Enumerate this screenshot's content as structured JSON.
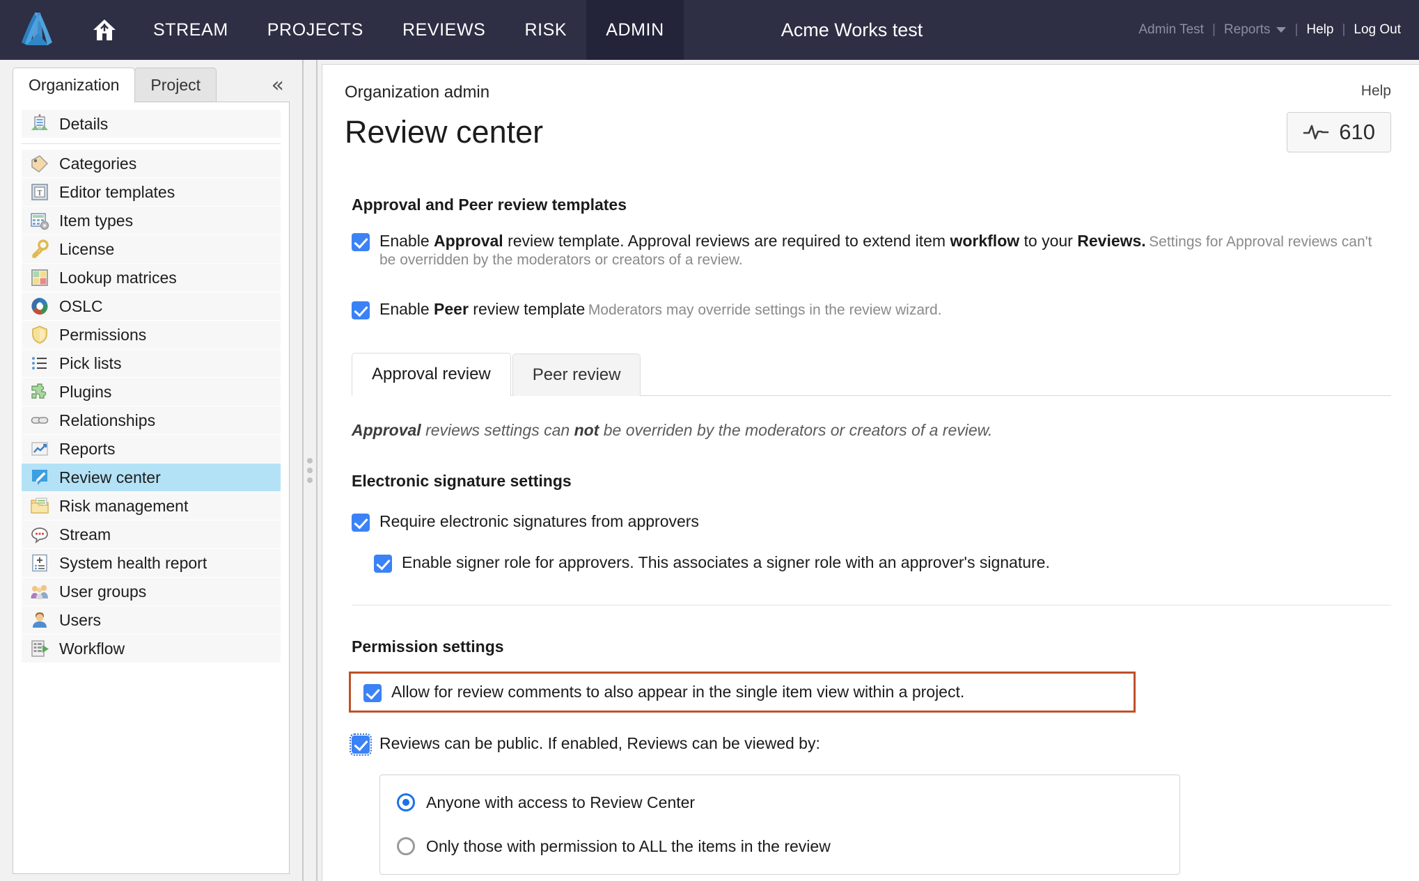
{
  "topnav": {
    "logo_icon": "jama-logo-icon",
    "home_icon": "home-icon",
    "tabs": [
      {
        "label": "STREAM",
        "active": false
      },
      {
        "label": "PROJECTS",
        "active": false
      },
      {
        "label": "REVIEWS",
        "active": false
      },
      {
        "label": "RISK",
        "active": false
      },
      {
        "label": "ADMIN",
        "active": true
      }
    ],
    "org_title": "Acme Works test",
    "user": "Admin Test",
    "reports": "Reports",
    "help": "Help",
    "logout": "Log Out",
    "sep": "|"
  },
  "sidebar": {
    "tabs": [
      {
        "label": "Organization",
        "active": true
      },
      {
        "label": "Project",
        "active": false
      }
    ],
    "collapse_icon": "chevron-double-left-icon",
    "items": [
      {
        "label": "Details",
        "icon": "building-icon",
        "selected": false,
        "sep_after": true
      },
      {
        "label": "Categories",
        "icon": "tag-icon",
        "selected": false
      },
      {
        "label": "Editor templates",
        "icon": "text-template-icon",
        "selected": false
      },
      {
        "label": "Item types",
        "icon": "item-types-icon",
        "selected": false
      },
      {
        "label": "License",
        "icon": "key-icon",
        "selected": false
      },
      {
        "label": "Lookup matrices",
        "icon": "matrix-icon",
        "selected": false
      },
      {
        "label": "OSLC",
        "icon": "oslc-ring-icon",
        "selected": false
      },
      {
        "label": "Permissions",
        "icon": "shield-icon",
        "selected": false
      },
      {
        "label": "Pick lists",
        "icon": "list-icon",
        "selected": false
      },
      {
        "label": "Plugins",
        "icon": "puzzle-icon",
        "selected": false
      },
      {
        "label": "Relationships",
        "icon": "chain-link-icon",
        "selected": false
      },
      {
        "label": "Reports",
        "icon": "chart-line-icon",
        "selected": false
      },
      {
        "label": "Review center",
        "icon": "pencil-note-icon",
        "selected": true
      },
      {
        "label": "Risk management",
        "icon": "folder-doc-icon",
        "selected": false
      },
      {
        "label": "Stream",
        "icon": "speech-bubble-icon",
        "selected": false
      },
      {
        "label": "System health report",
        "icon": "clipboard-health-icon",
        "selected": false
      },
      {
        "label": "User groups",
        "icon": "users-group-icon",
        "selected": false
      },
      {
        "label": "Users",
        "icon": "user-icon",
        "selected": false
      },
      {
        "label": "Workflow",
        "icon": "workflow-icon",
        "selected": false
      }
    ]
  },
  "main": {
    "breadcrumb": "Organization admin",
    "help_link": "Help",
    "page_title": "Review center",
    "pulse_badge": {
      "icon": "activity-pulse-icon",
      "value": "610"
    },
    "templates_section": {
      "heading": "Approval and Peer review templates",
      "approval": {
        "checked": true,
        "text_parts": [
          {
            "t": "Enable ",
            "bold": false
          },
          {
            "t": "Approval",
            "bold": true
          },
          {
            "t": " review template. Approval reviews are required to extend item ",
            "bold": false
          },
          {
            "t": "workflow",
            "bold": true
          },
          {
            "t": " to your ",
            "bold": false
          },
          {
            "t": "Reviews.",
            "bold": true
          }
        ],
        "sub": "Settings for Approval reviews can't be overridden by the moderators or creators of a review."
      },
      "peer": {
        "checked": true,
        "text_parts": [
          {
            "t": "Enable ",
            "bold": false
          },
          {
            "t": "Peer",
            "bold": true
          },
          {
            "t": " review template",
            "bold": false
          }
        ],
        "sub": "Moderators may override settings in the review wizard."
      }
    },
    "review_tabs": [
      {
        "label": "Approval review",
        "active": true
      },
      {
        "label": "Peer review",
        "active": false
      }
    ],
    "override_note_parts": [
      {
        "t": "Approval",
        "bold": true
      },
      {
        "t": " reviews settings can ",
        "bold": false
      },
      {
        "t": "not",
        "bold": true
      },
      {
        "t": " be overriden by the moderators or creators of a review.",
        "bold": false
      }
    ],
    "esig_section": {
      "heading": "Electronic signature settings",
      "require_sig": {
        "checked": true,
        "label": "Require electronic signatures from approvers"
      },
      "signer_role": {
        "checked": true,
        "label": "Enable signer role for approvers. This associates a signer role with an approver's signature."
      }
    },
    "permission_section": {
      "heading": "Permission settings",
      "comments_in_item_view": {
        "checked": true,
        "highlighted": true,
        "label": "Allow for review comments to also appear in the single item view within a project."
      },
      "public_reviews": {
        "checked": true,
        "focused": true,
        "label": "Reviews can be public. If enabled, Reviews can be viewed by:"
      },
      "visibility_options": [
        {
          "label": "Anyone with access to Review Center",
          "selected": true
        },
        {
          "label": "Only those with permission to ALL the items in the review",
          "selected": false
        }
      ]
    }
  },
  "colors": {
    "nav_bg": "#2e2e44",
    "nav_active_bg": "#23233a",
    "checkbox_blue": "#3b82f6",
    "radio_blue": "#1a73e8",
    "selected_item_blue": "#b3e2f7",
    "highlight_border": "#c0502a"
  }
}
